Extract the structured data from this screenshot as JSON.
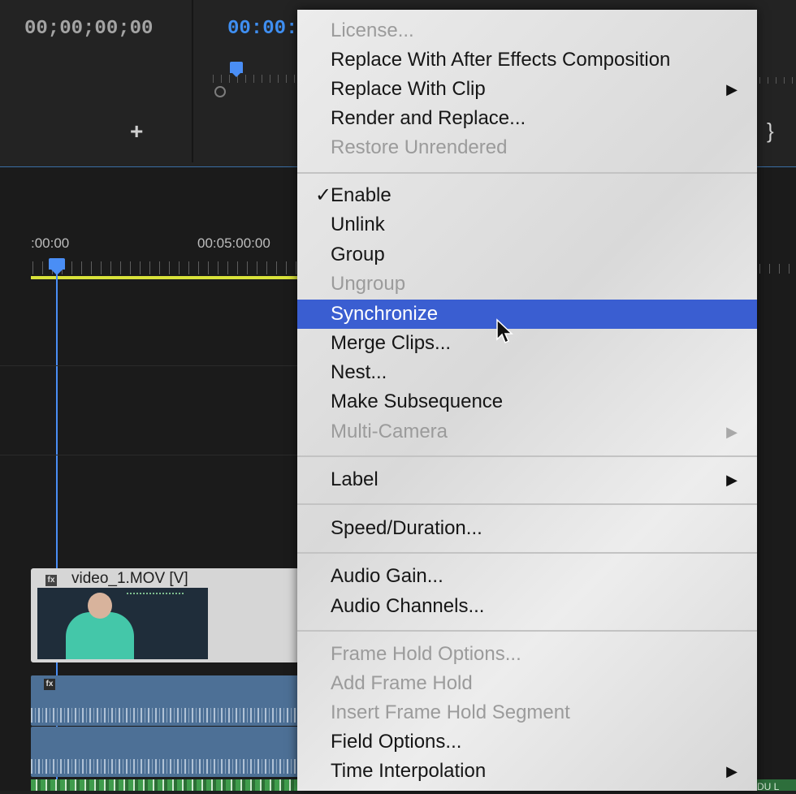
{
  "timeline": {
    "timecode_left": "00;00;00;00",
    "timecode_right": "00:00:",
    "ruler_start": ":00:00",
    "ruler_mid": "00:05:00:00",
    "add_label": "+",
    "brace_label": "}"
  },
  "clips": {
    "video_title": "video_1.MOV [V]",
    "fx_label": "fx",
    "audio_badge": "fx",
    "right_strip_text": "DU L"
  },
  "menu": {
    "items": [
      {
        "label": "License...",
        "disabled": true
      },
      {
        "label": "Replace With After Effects Composition",
        "disabled": false
      },
      {
        "label": "Replace With Clip",
        "disabled": false,
        "submenu": true
      },
      {
        "label": "Render and Replace...",
        "disabled": false
      },
      {
        "label": "Restore Unrendered",
        "disabled": true
      },
      {
        "label": "Enable",
        "disabled": false,
        "checked": true
      },
      {
        "label": "Unlink",
        "disabled": false
      },
      {
        "label": "Group",
        "disabled": false
      },
      {
        "label": "Ungroup",
        "disabled": true
      },
      {
        "label": "Synchronize",
        "disabled": false,
        "highlighted": true
      },
      {
        "label": "Merge Clips...",
        "disabled": false
      },
      {
        "label": "Nest...",
        "disabled": false
      },
      {
        "label": "Make Subsequence",
        "disabled": false
      },
      {
        "label": "Multi-Camera",
        "disabled": true,
        "submenu": true
      },
      {
        "label": "Label",
        "disabled": false,
        "submenu": true
      },
      {
        "label": "Speed/Duration...",
        "disabled": false
      },
      {
        "label": "Audio Gain...",
        "disabled": false
      },
      {
        "label": "Audio Channels...",
        "disabled": false
      },
      {
        "label": "Frame Hold Options...",
        "disabled": true
      },
      {
        "label": "Add Frame Hold",
        "disabled": true
      },
      {
        "label": "Insert Frame Hold Segment",
        "disabled": true
      },
      {
        "label": "Field Options...",
        "disabled": false
      },
      {
        "label": "Time Interpolation",
        "disabled": false,
        "submenu": true
      }
    ],
    "check_glyph": "✓",
    "submenu_glyph": "▶"
  },
  "colors": {
    "highlight": "#3a5ed1",
    "playhead": "#4a8ef5",
    "timecode_blue": "#3f8ff2",
    "work_area": "#d9e23a"
  }
}
